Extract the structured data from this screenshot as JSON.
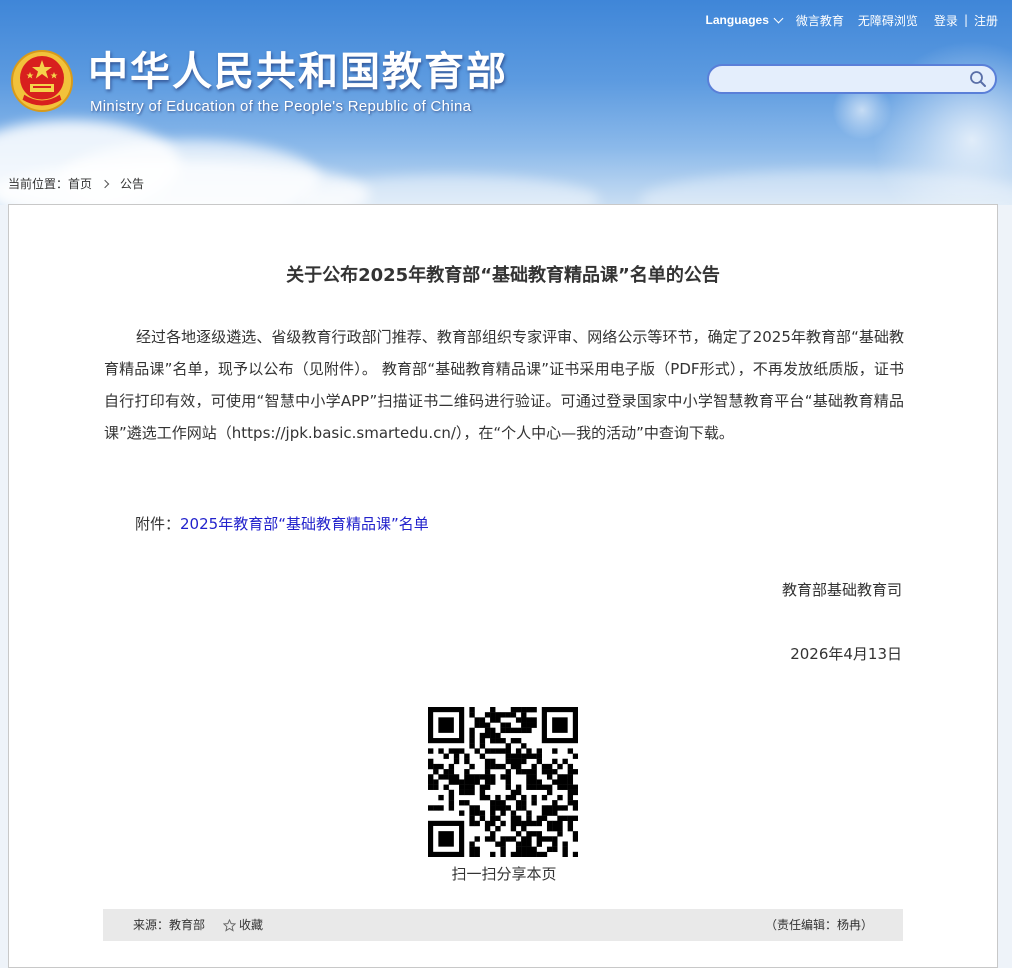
{
  "header": {
    "site_title": "中华人民共和国教育部",
    "site_subtitle": "Ministry of Education of the People's Republic of China",
    "topnav": {
      "languages": "Languages",
      "weiyan": "微言教育",
      "accessibility": "无障碍浏览",
      "login": "登录",
      "separator": "|",
      "register": "注册"
    },
    "search": {
      "placeholder": "",
      "icon": "search-icon"
    }
  },
  "breadcrumb": {
    "prefix": "当前位置：",
    "home": "首页",
    "current": "公告"
  },
  "article": {
    "title": "关于公布2025年教育部“基础教育精品课”名单的公告",
    "body": "经过各地逐级遴选、省级教育行政部门推荐、教育部组织专家评审、网络公示等环节，确定了2025年教育部“基础教育精品课”名单，现予以公布（见附件）。 教育部“基础教育精品课”证书采用电子版（PDF形式），不再发放纸质版，证书自行打印有效，可使用“智慧中小学APP”扫描证书二维码进行验证。可通过登录国家中小学智慧教育平台“基础教育精品课”遴选工作网站（https://jpk.basic.smartedu.cn/），在“个人中心—我的活动”中查询下载。",
    "attachment_label": "附件：",
    "attachment_link": "2025年教育部“基础教育精品课”名单",
    "signature": "教育部基础教育司",
    "date": "2026年4月13日"
  },
  "qr": {
    "caption": "扫一扫分享本页"
  },
  "footer": {
    "source": "来源：教育部",
    "favorite": "收藏",
    "editor": "（责任编辑：杨冉）"
  },
  "colors": {
    "header_top": "#3f86d8",
    "link": "#2222cc",
    "footer_bar": "#e9e9e9",
    "search_border": "#5a7fd8"
  }
}
